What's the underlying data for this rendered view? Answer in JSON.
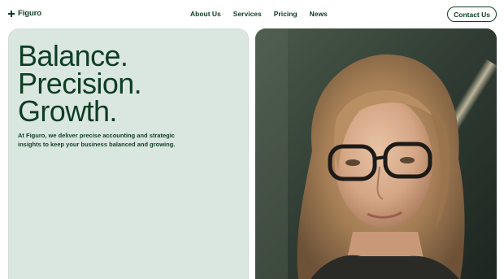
{
  "header": {
    "logo_text": "Figuro",
    "logo_icon": "plus-icon",
    "nav": [
      "About Us",
      "Services",
      "Pricing",
      "News"
    ],
    "contact_label": "Contact Us"
  },
  "hero": {
    "headline": [
      "Balance.",
      "Precision.",
      "Growth."
    ],
    "subtext": "At Figuro, we deliver precise accounting and strategic insights to keep your business balanced and growing.",
    "card_color": "#dae7e0",
    "brand_color": "#0f3d24"
  },
  "photo": {
    "subject": "portrait-photo"
  }
}
